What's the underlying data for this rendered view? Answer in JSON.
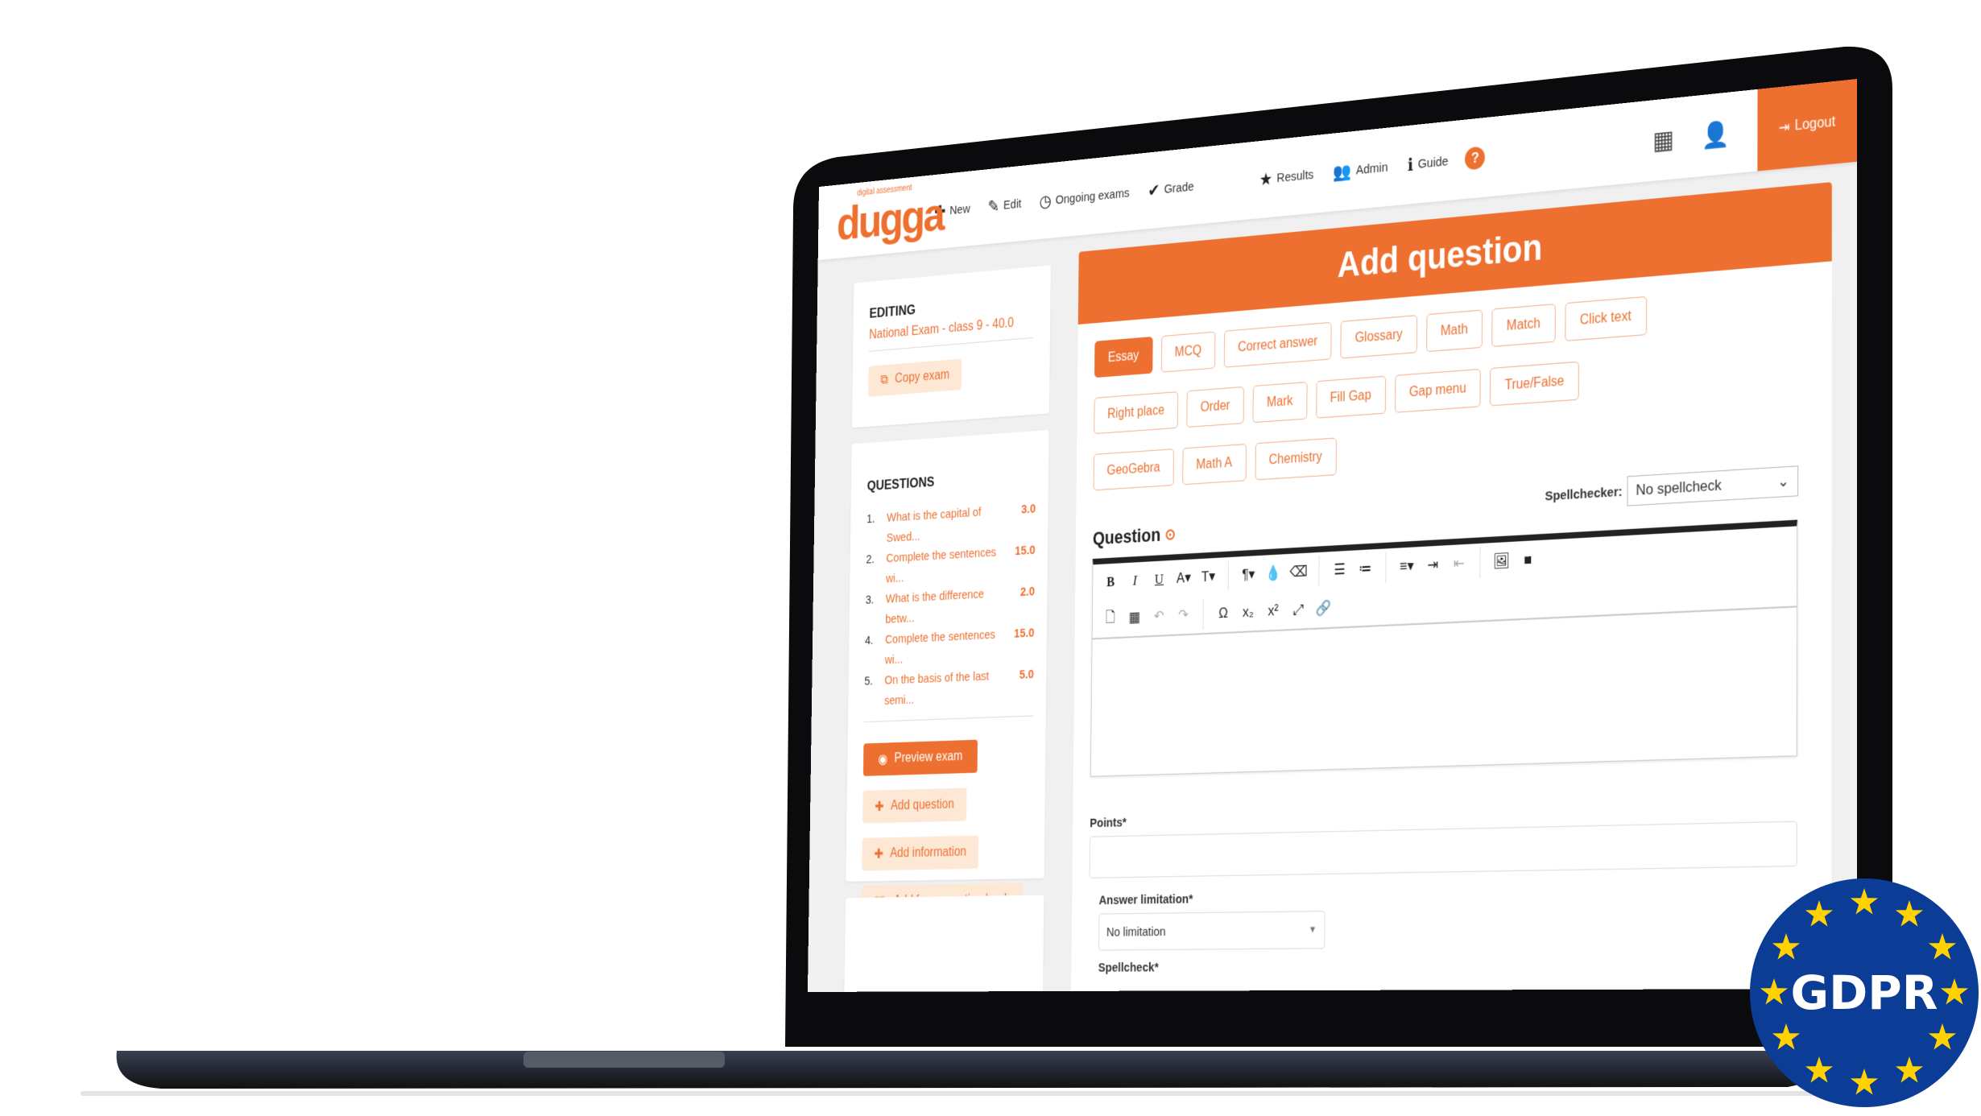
{
  "nav": {
    "logo_text": "dugga",
    "logo_tagline": "digital assessment",
    "items": [
      {
        "label": "New",
        "icon": "plus-icon"
      },
      {
        "label": "Edit",
        "icon": "edit-icon"
      },
      {
        "label": "Ongoing exams",
        "icon": "clock-icon"
      },
      {
        "label": "Grade",
        "icon": "check-icon"
      },
      {
        "label": "Results",
        "icon": "star-icon"
      },
      {
        "label": "Admin",
        "icon": "users-icon"
      },
      {
        "label": "Guide",
        "icon": "info-icon"
      }
    ],
    "help": "?",
    "logout": "Logout"
  },
  "sidebar": {
    "editing_heading": "EDITING",
    "exam_name": "National Exam - class 9 - 40.0",
    "copy_exam": "Copy exam",
    "questions_heading": "QUESTIONS",
    "questions": [
      {
        "num": "1.",
        "title": "What is the capital of Swed...",
        "points": "3.0"
      },
      {
        "num": "2.",
        "title": "Complete the sentences wi...",
        "points": "15.0"
      },
      {
        "num": "3.",
        "title": "What is the difference betw...",
        "points": "2.0"
      },
      {
        "num": "4.",
        "title": "Complete the sentences wi...",
        "points": "15.0"
      },
      {
        "num": "5.",
        "title": "On the basis of the last semi...",
        "points": "5.0"
      }
    ],
    "preview_exam": "Preview exam",
    "add_question": "Add question",
    "add_information": "Add information",
    "add_from_bank": "Add from question bank"
  },
  "main": {
    "title": "Add question",
    "types": [
      "Essay",
      "MCQ",
      "Correct answer",
      "Glossary",
      "Math",
      "Match",
      "Click text",
      "Right place",
      "Order",
      "Mark",
      "Fill Gap",
      "Gap menu",
      "True/False",
      "GeoGebra",
      "Math A",
      "Chemistry"
    ],
    "active_type": "Essay",
    "spellchecker_label": "Spellchecker:",
    "spellchecker_value": "No spellcheck",
    "question_label": "Question",
    "points_label": "Points*",
    "points_value": "",
    "answer_limitation_label": "Answer limitation*",
    "answer_limitation_value": "No limitation",
    "spellcheck_label": "Spellcheck*"
  },
  "badge": {
    "text": "GDPR"
  },
  "colors": {
    "accent": "#ee7030",
    "eu_blue": "#0b3c96",
    "eu_star": "#ffd200",
    "device": "#1f2430"
  }
}
